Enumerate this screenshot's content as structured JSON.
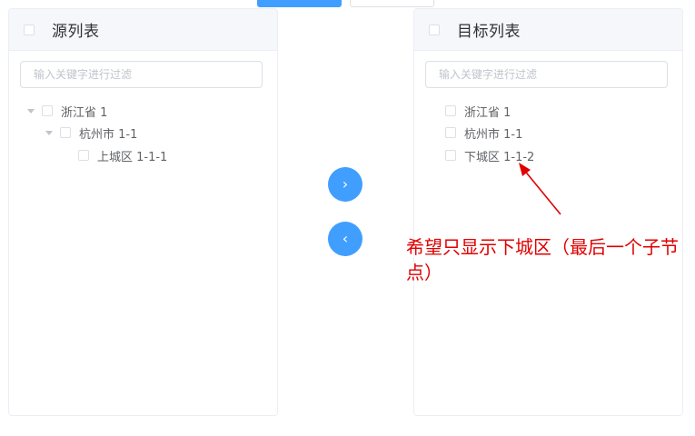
{
  "source_panel": {
    "title": "源列表",
    "filter_placeholder": "输入关键字进行过滤",
    "tree": [
      {
        "label": "浙江省 1",
        "level": 0
      },
      {
        "label": "杭州市 1-1",
        "level": 1
      },
      {
        "label": "上城区 1-1-1",
        "level": 2
      }
    ]
  },
  "target_panel": {
    "title": "目标列表",
    "filter_placeholder": "输入关键字进行过滤",
    "items": [
      {
        "label": "浙江省 1"
      },
      {
        "label": "杭州市 1-1"
      },
      {
        "label": "下城区 1-1-2"
      }
    ]
  },
  "transfer": {
    "to_right_icon": "›",
    "to_left_icon": "‹"
  },
  "annotation": {
    "text": "希望只显示下城区（最后一个子节点）"
  },
  "colors": {
    "primary": "#409eff",
    "annotation": "#e00000"
  }
}
